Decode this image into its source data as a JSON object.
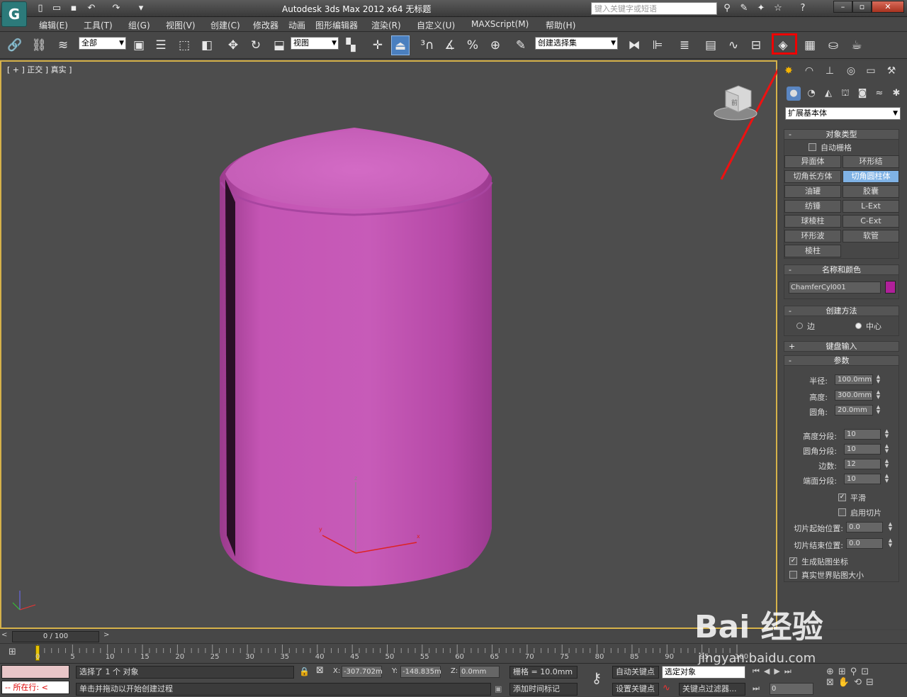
{
  "window": {
    "title": "Autodesk 3ds Max  2012 x64      无标题",
    "search_placeholder": "键入关键字或短语"
  },
  "menu": [
    "编辑(E)",
    "工具(T)",
    "组(G)",
    "视图(V)",
    "创建(C)",
    "修改器",
    "动画",
    "图形编辑器",
    "渲染(R)",
    "自定义(U)",
    "MAXScript(M)",
    "帮助(H)"
  ],
  "toolbar": {
    "filter_value": "全部",
    "coord_value": "视图",
    "selection_set": "创建选择集",
    "highlighted_tool": "render-setup-button"
  },
  "viewport": {
    "label": "[ + ] 正交 ] 真实 ]",
    "object_color": "#c050b0",
    "border_color": "#d6b24a"
  },
  "command_panel": {
    "category": "扩展基本体",
    "object_type": {
      "title": "对象类型",
      "autogrid": "自动栅格",
      "buttons": [
        "异面体",
        "环形结",
        "切角长方体",
        "切角圆柱体",
        "油罐",
        "胶囊",
        "纺锤",
        "L-Ext",
        "球棱柱",
        "C-Ext",
        "环形波",
        "软管",
        "棱柱"
      ],
      "active": "切角圆柱体"
    },
    "name_color": {
      "title": "名称和颜色",
      "name": "ChamferCyl001",
      "color": "#b0209a"
    },
    "creation_method": {
      "title": "创建方法",
      "options": [
        "边",
        "中心"
      ],
      "selected": "中心"
    },
    "keyboard_entry": "键盘输入",
    "parameters": {
      "title": "参数",
      "radius_label": "半径:",
      "radius": "100.0mm",
      "height_label": "高度:",
      "height": "300.0mm",
      "fillet_label": "圆角:",
      "fillet": "20.0mm",
      "height_segs_label": "高度分段:",
      "height_segs": "10",
      "fillet_segs_label": "圆角分段:",
      "fillet_segs": "10",
      "sides_label": "边数:",
      "sides": "12",
      "cap_segs_label": "端面分段:",
      "cap_segs": "10",
      "smooth_label": "平滑",
      "slice_on_label": "启用切片",
      "slice_from_label": "切片起始位置:",
      "slice_from": "0.0",
      "slice_to_label": "切片结束位置:",
      "slice_to": "0.0",
      "gen_map_label": "生成贴图坐标",
      "real_world_label": "真实世界贴图大小"
    }
  },
  "timeline": {
    "frame": "0 / 100",
    "ticks": [
      "0",
      "5",
      "10",
      "15",
      "20",
      "25",
      "30",
      "35",
      "40",
      "45",
      "50",
      "55",
      "60",
      "65",
      "70",
      "75",
      "80",
      "85",
      "90",
      "95",
      "100"
    ]
  },
  "status": {
    "selected": "选择了 1 个 对象",
    "prompt": "单击并拖动以开始创建过程",
    "location": "所在行:",
    "x": "-307.702m",
    "y": "-148.835m",
    "z": "0.0mm",
    "grid": "栅格 = 10.0mm",
    "add_time_tag": "添加时间标记",
    "auto_key": "自动关键点",
    "set_key": "设置关键点",
    "key_mode": "选定对象",
    "key_filters": "关键点过滤器...",
    "frame_field": "0"
  },
  "watermark": {
    "brand": "Bai 经验",
    "url": "jingyan.baidu.com"
  }
}
